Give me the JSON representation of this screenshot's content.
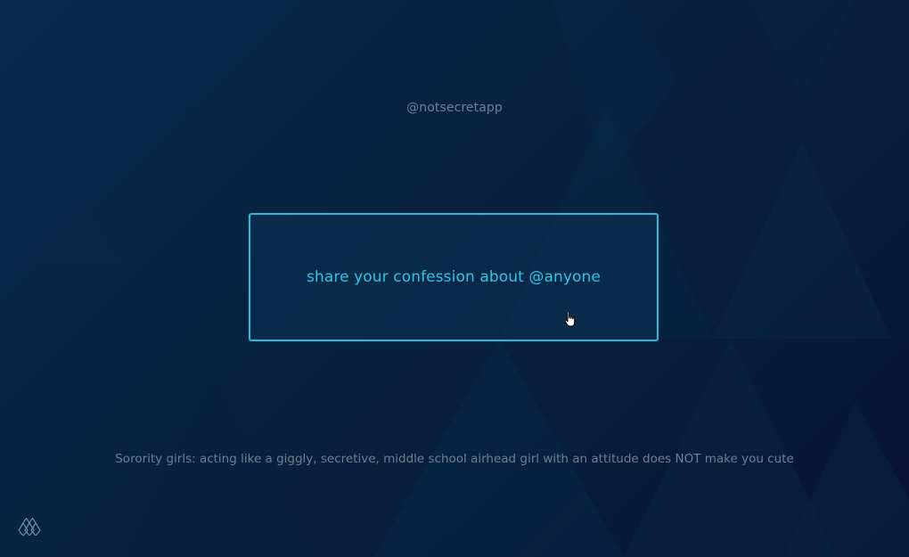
{
  "header": {
    "handle": "@notsecretapp"
  },
  "main": {
    "confession_prompt": "share your confession about @anyone"
  },
  "footer": {
    "sample_confession": "Sorority girls: acting like a giggly, secretive, middle school airhead girl with an attitude does NOT make you cute"
  },
  "icons": {
    "logo": "diamond-lattice-logo-icon",
    "cursor": "hand-pointer-cursor-icon"
  },
  "colors": {
    "accent": "#21bde0",
    "prompt_text": "#2cc6e6",
    "muted_text": "#6c7f93",
    "background": "#082340"
  }
}
